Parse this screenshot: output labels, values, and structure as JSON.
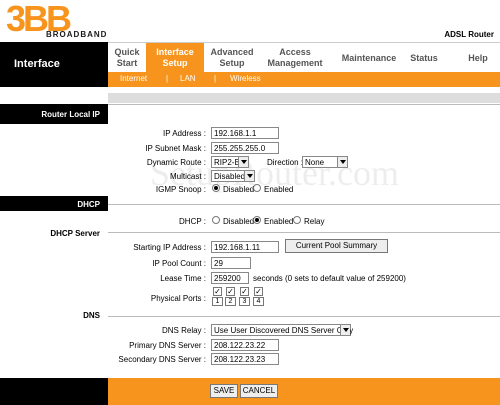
{
  "header": {
    "logo_text": "3BB",
    "logo_sub": "BROADBAND",
    "title": "ADSL Router"
  },
  "nav": {
    "section": "Interface",
    "items": [
      {
        "label": "Quick Start"
      },
      {
        "label": "Interface Setup"
      },
      {
        "label": "Advanced Setup"
      },
      {
        "label": "Access Management"
      },
      {
        "label": "Maintenance"
      },
      {
        "label": "Status"
      },
      {
        "label": "Help"
      }
    ],
    "subitems": [
      "Internet",
      "LAN",
      "Wireless"
    ]
  },
  "watermark": "SetupRouter.com",
  "sections": {
    "router_local_ip": "Router Local IP",
    "dhcp": "DHCP",
    "dhcp_server": "DHCP Server",
    "dns": "DNS"
  },
  "local_ip": {
    "ip_label": "IP Address :",
    "ip_value": "192.168.1.1",
    "mask_label": "IP Subnet Mask :",
    "mask_value": "255.255.255.0",
    "route_label": "Dynamic Route :",
    "route_value": "RIP2-B",
    "direction_label": "Direction :",
    "direction_value": "None",
    "multicast_label": "Multicast :",
    "multicast_value": "Disabled",
    "igmp_label": "IGMP Snoop :",
    "igmp_disabled": "Disabled",
    "igmp_enabled": "Enabled"
  },
  "dhcp": {
    "label": "DHCP :",
    "opt_disabled": "Disabled",
    "opt_enabled": "Enabled",
    "opt_relay": "Relay"
  },
  "dhcp_server": {
    "start_label": "Starting IP Address :",
    "start_value": "192.168.1.11",
    "pool_button": "Current Pool Summary",
    "count_label": "IP Pool Count :",
    "count_value": "29",
    "lease_label": "Lease Time :",
    "lease_value": "259200",
    "lease_unit": "seconds",
    "lease_note": "(0 sets to default value of 259200)",
    "ports_label": "Physical Ports :",
    "ports": [
      "1",
      "2",
      "3",
      "4"
    ],
    "port_check": "✓"
  },
  "dns": {
    "relay_label": "DNS Relay :",
    "relay_value": "Use User Discovered DNS Server Only",
    "primary_label": "Primary DNS Server :",
    "primary_value": "208.122.23.22",
    "secondary_label": "Secondary DNS Server :",
    "secondary_value": "208.122.23.23"
  },
  "footer": {
    "save": "SAVE",
    "cancel": "CANCEL"
  }
}
